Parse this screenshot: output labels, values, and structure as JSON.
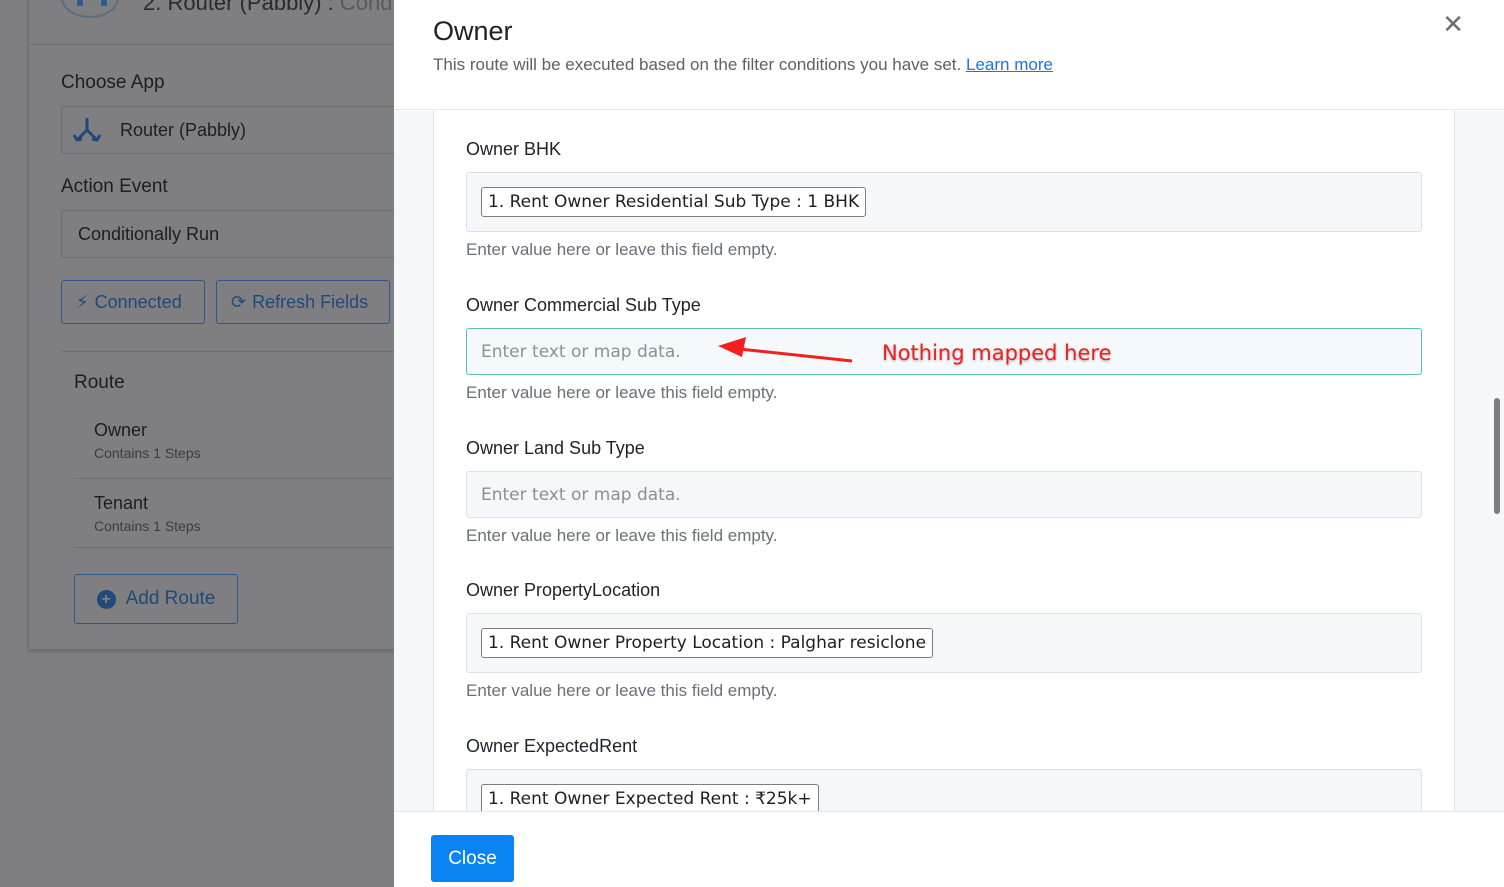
{
  "background": {
    "step_title": "2. Router (Pabbly) :",
    "step_title_suffix": "Cond",
    "choose_app_label": "Choose App",
    "app_value": "Router (Pabbly)",
    "action_event_label": "Action Event",
    "action_event_value": "Conditionally Run",
    "connected_label": "Connected",
    "refresh_label": "Refresh Fields",
    "route_title": "Route",
    "routes": [
      {
        "name": "Owner",
        "sub": "Contains 1 Steps"
      },
      {
        "name": "Tenant",
        "sub": "Contains 1 Steps"
      }
    ],
    "add_route_label": "Add Route"
  },
  "modal": {
    "title": "Owner",
    "subtitle": "This route will be executed based on the filter conditions you have set.",
    "learn_more": "Learn more",
    "close_icon": "close-icon",
    "close_button": "Close",
    "help_text": "Enter value here or leave this field empty.",
    "placeholder": "Enter text or map data.",
    "fields": [
      {
        "label": "Owner BHK",
        "tag": "1. Rent Owner Residential Sub Type : 1 BHK"
      },
      {
        "label": "Owner Commercial Sub Type",
        "tag": ""
      },
      {
        "label": "Owner Land Sub Type",
        "tag": ""
      },
      {
        "label": "Owner PropertyLocation",
        "tag": "1. Rent Owner Property Location : Palghar resiclone"
      },
      {
        "label": "Owner ExpectedRent",
        "tag": "1. Rent Owner Expected Rent : ₹25k+"
      }
    ],
    "annotation": "Nothing mapped here"
  },
  "colors": {
    "primary": "#0b84f3",
    "link": "#1a73e8",
    "annotation": "#f02020",
    "focus_border": "#5bbfb0"
  }
}
